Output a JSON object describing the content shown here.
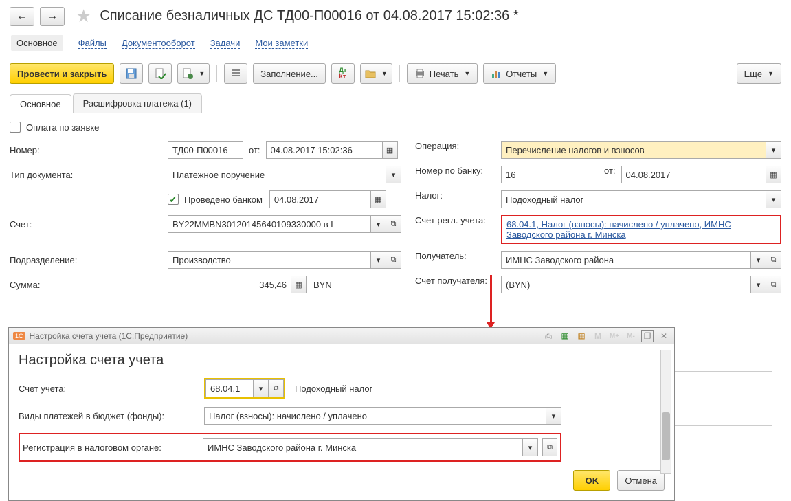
{
  "header": {
    "title": "Списание безналичных ДС ТД00-П00016 от 04.08.2017 15:02:36 *"
  },
  "nav": {
    "main": "Основное",
    "files": "Файлы",
    "docflow": "Документооборот",
    "tasks": "Задачи",
    "notes": "Мои заметки"
  },
  "toolbar": {
    "post_close": "Провести и закрыть",
    "fill": "Заполнение...",
    "print": "Печать",
    "reports": "Отчеты",
    "dtkt_top": "Дт",
    "dtkt_bottom": "Кт",
    "more": "Еще"
  },
  "tabs": {
    "main": "Основное",
    "detail": "Расшифровка платежа (1)"
  },
  "form": {
    "pay_by_request": "Оплата по заявке",
    "number_label": "Номер:",
    "number_value": "ТД00-П00016",
    "from_label": "от:",
    "number_date": "04.08.2017 15:02:36",
    "operation_label": "Операция:",
    "operation_value": "Перечисление налогов и взносов",
    "doctype_label": "Тип документа:",
    "doctype_value": "Платежное поручение",
    "banknum_label": "Номер по банку:",
    "banknum_value": "16",
    "bank_from_label": "от:",
    "bank_date": "04.08.2017",
    "bank_posted_label": "Проведено банком",
    "bank_posted_date": "04.08.2017",
    "tax_label": "Налог:",
    "tax_value": "Подоходный налог",
    "account_label": "Счет:",
    "account_value": "BY22MMBN30120145640109330000 в L",
    "regl_account_label": "Счет регл. учета:",
    "regl_account_link": "68.04.1, Налог (взносы): начислено / уплачено, ИМНС Заводского района г. Минска",
    "dept_label": "Подразделение:",
    "dept_value": "Производство",
    "recipient_label": "Получатель:",
    "recipient_value": "ИМНС Заводского района",
    "sum_label": "Сумма:",
    "sum_value": "345,46",
    "currency": "BYN",
    "recip_acc_label": "Счет получателя:",
    "recip_acc_value": "(BYN)"
  },
  "dialog": {
    "titlebar_icon": "1С",
    "titlebar": "Настройка счета учета  (1С:Предприятие)",
    "title": "Настройка счета учета",
    "account_label": "Счет учета:",
    "account_value": "68.04.1",
    "account_name": "Подоходный налог",
    "paytype_label": "Виды платежей в бюджет (фонды):",
    "paytype_value": "Налог (взносы): начислено / уплачено",
    "taxreg_label": "Регистрация в налоговом органе:",
    "taxreg_value": "ИМНС Заводского района г. Минска",
    "ok": "OK",
    "cancel": "Отмена",
    "m": "M",
    "mplus": "M+",
    "mminus": "M-"
  }
}
